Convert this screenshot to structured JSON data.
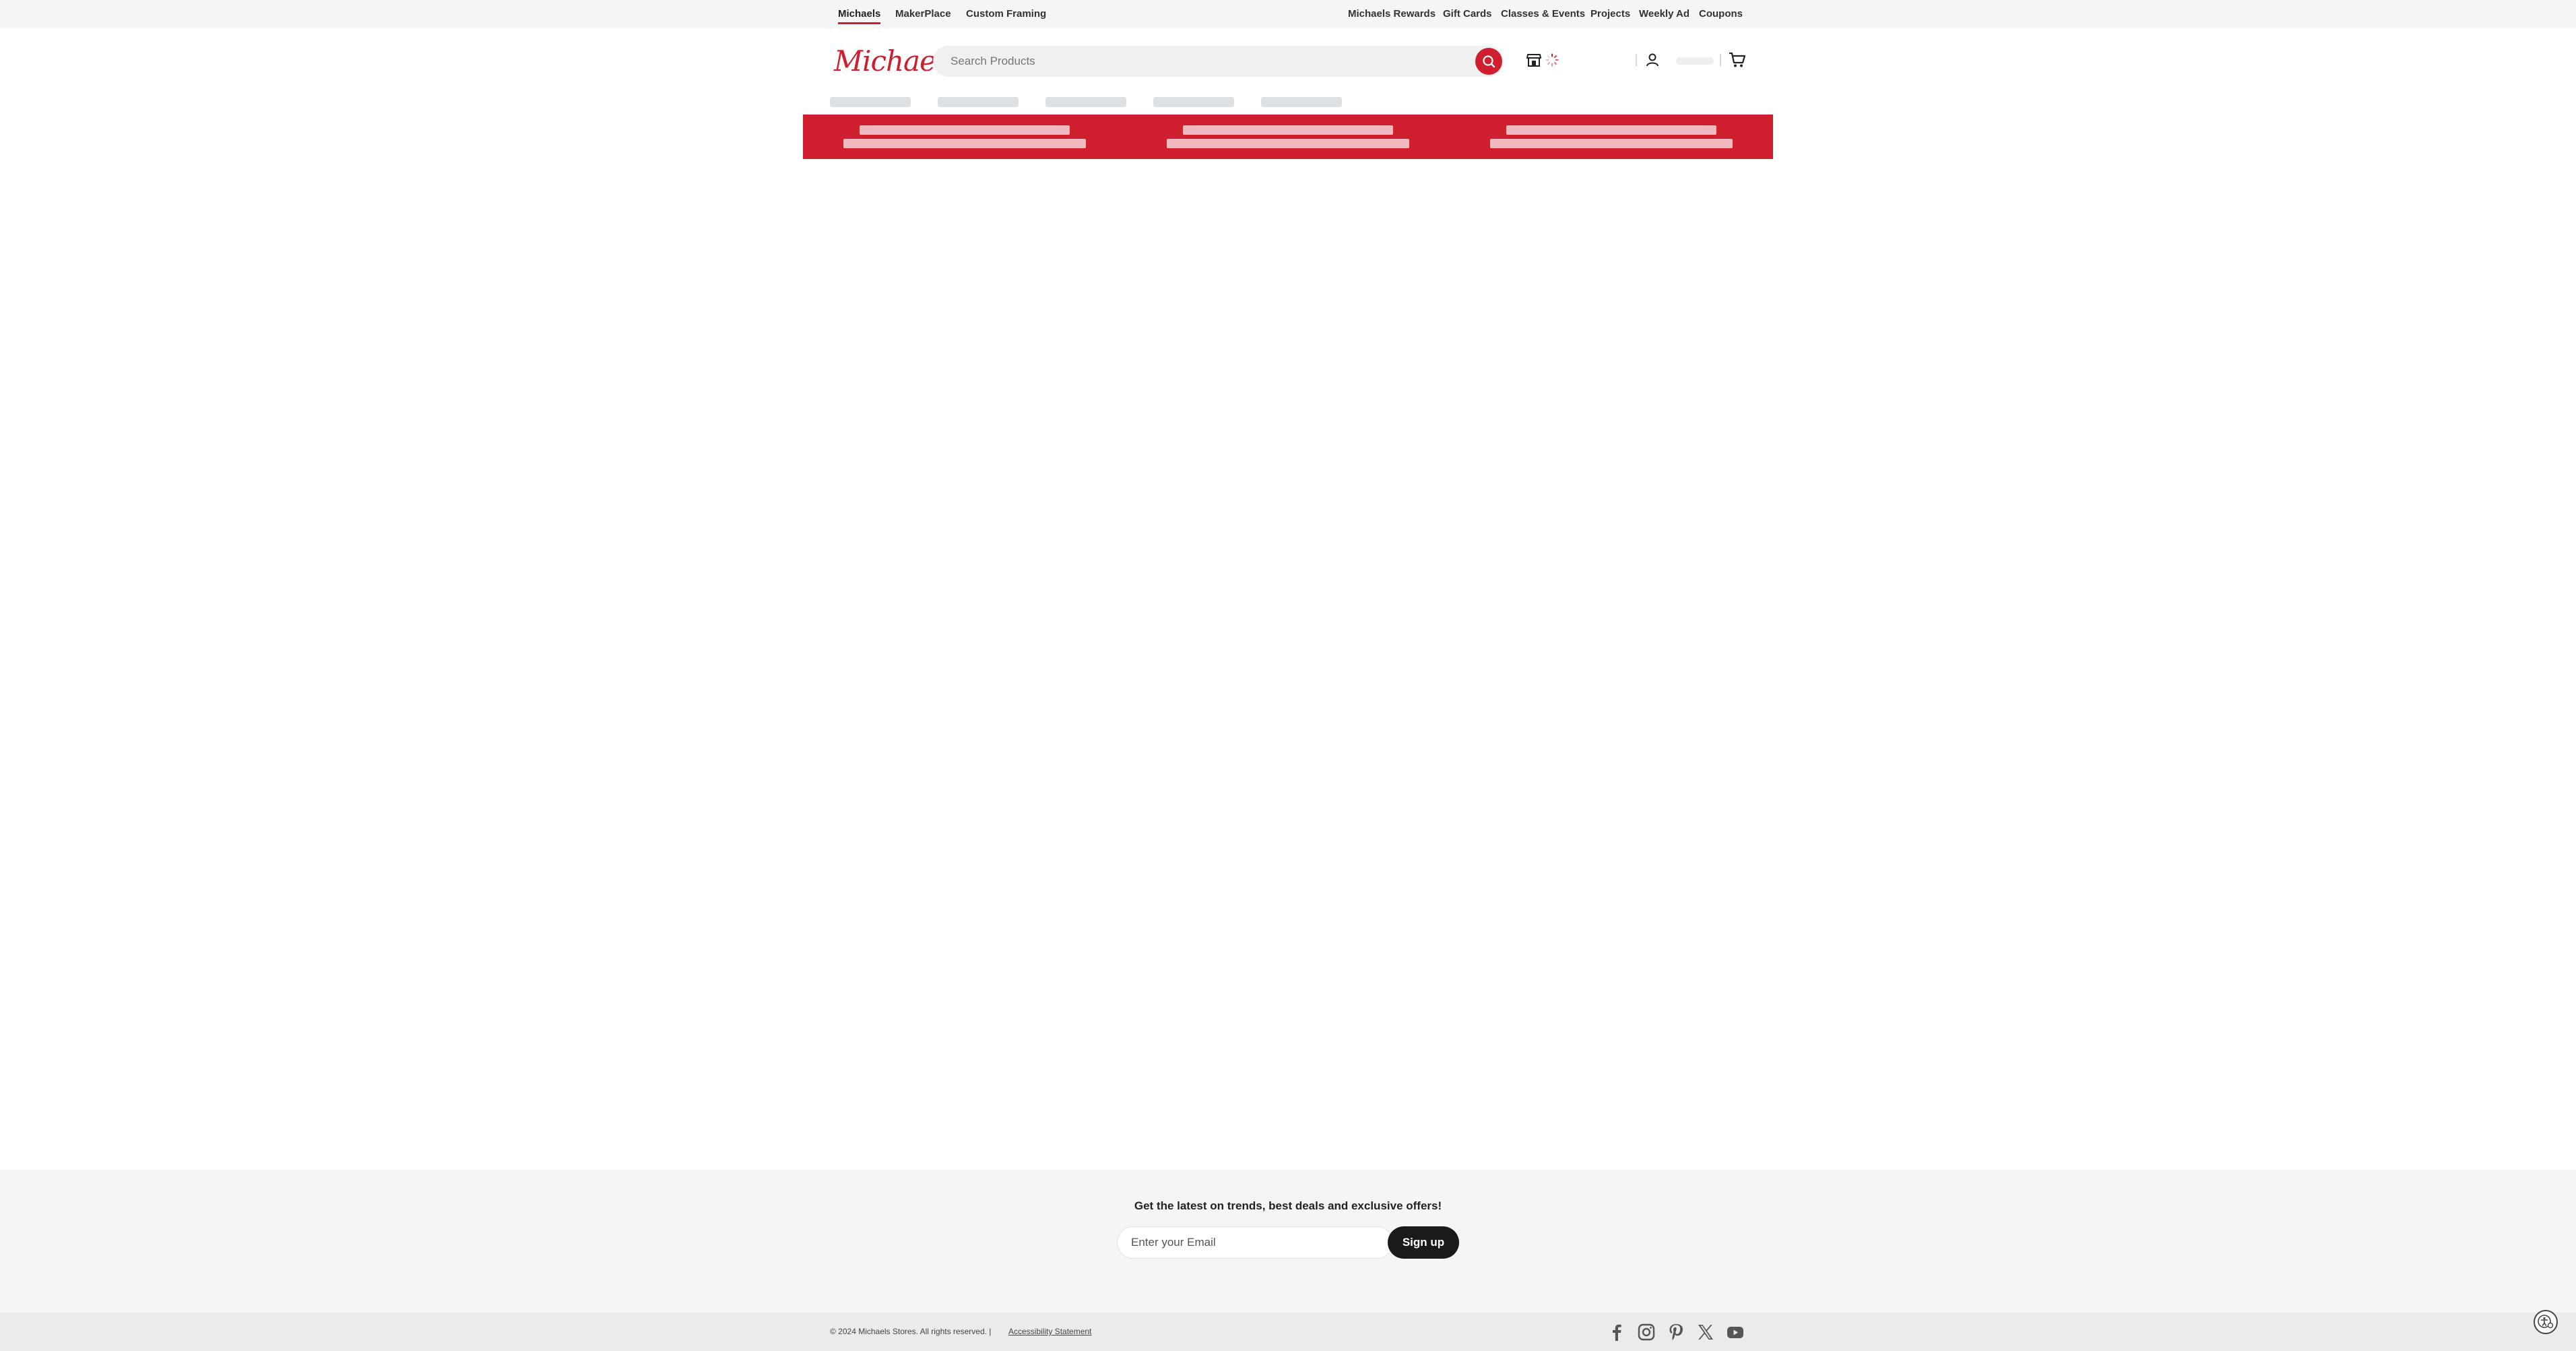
{
  "topbar": {
    "left_links": [
      "Michaels",
      "MakerPlace",
      "Custom Framing"
    ],
    "right_links": [
      "Michaels Rewards",
      "Gift Cards",
      "Classes & Events",
      "Projects",
      "Weekly Ad",
      "Coupons"
    ]
  },
  "header": {
    "logo_text": "Michaels",
    "search_placeholder": "Search Products",
    "icons": [
      "search-icon",
      "store-icon",
      "loading-spinner-icon",
      "user-icon",
      "cart-icon"
    ]
  },
  "newsletter": {
    "title": "Get the latest on trends, best deals and exclusive offers!",
    "email_placeholder": "Enter your Email",
    "signup_label": "Sign up"
  },
  "footer": {
    "copyright": "© 2024 Michaels Stores. All rights reserved. |",
    "accessibility_link": "Accessibility Statement",
    "social_icons": [
      "facebook-icon",
      "instagram-icon",
      "pinterest-icon",
      "x-icon",
      "youtube-icon"
    ]
  },
  "colors": {
    "brand_red": "#cf1f2f",
    "topbar_bg": "#f5f5f5",
    "skeleton": "#dde0e5",
    "dark_button": "#1a1a1a"
  }
}
